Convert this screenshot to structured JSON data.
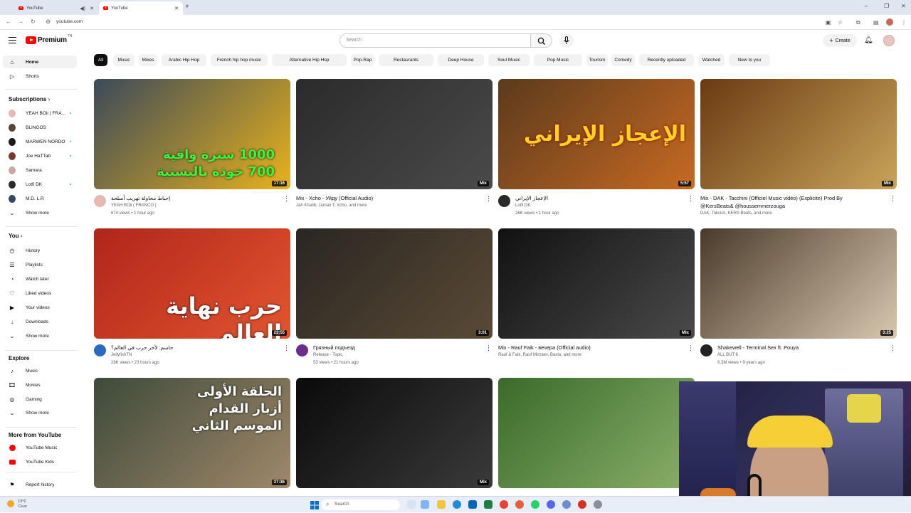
{
  "browser": {
    "tabs": [
      {
        "title": "YouTube",
        "active": false
      },
      {
        "title": "YouTube",
        "active": true
      }
    ],
    "url": "youtube.com"
  },
  "header": {
    "logo_text": "Premium",
    "logo_sup": "TN",
    "search_placeholder": "Search",
    "create_label": "Create"
  },
  "chips": [
    "All",
    "Music",
    "Mixes",
    "Arabic Hip Hop",
    "French hip hop music",
    "Alternative Hip Hop",
    "Pop-Rap",
    "Restaurants",
    "Deep House",
    "Soul Music",
    "Pop Music",
    "Tourism",
    "Comedy",
    "Recently uploaded",
    "Watched",
    "New to you"
  ],
  "sidebar": {
    "top": [
      {
        "label": "Home",
        "icon": "home-icon"
      },
      {
        "label": "Shorts",
        "icon": "shorts-icon"
      }
    ],
    "subscriptions_title": "Subscriptions",
    "subscriptions": [
      {
        "label": "YEAH BOii ( FRA...",
        "dot": true,
        "color": "#e6b9b3"
      },
      {
        "label": "BLINGOS",
        "dot": false,
        "color": "#5a4636"
      },
      {
        "label": "MARWEN NORDO",
        "dot": true,
        "color": "#1a1a1a"
      },
      {
        "label": "Joe HaTTab",
        "dot": true,
        "color": "#7a3a2a"
      },
      {
        "label": "Samara",
        "dot": false,
        "color": "#c9a9a0"
      },
      {
        "label": "Lotfi DK",
        "dot": true,
        "color": "#2a2a2a"
      },
      {
        "label": "M.D. L.R",
        "dot": false,
        "color": "#34495e"
      }
    ],
    "show_more": "Show more",
    "you_title": "You",
    "you": [
      {
        "label": "History",
        "icon": "history-icon"
      },
      {
        "label": "Playlists",
        "icon": "playlists-icon"
      },
      {
        "label": "Watch later",
        "icon": "watch-later-icon"
      },
      {
        "label": "Liked videos",
        "icon": "like-icon"
      },
      {
        "label": "Your videos",
        "icon": "your-videos-icon"
      },
      {
        "label": "Downloads",
        "icon": "download-icon"
      }
    ],
    "explore_title": "Explore",
    "explore": [
      {
        "label": "Music",
        "icon": "music-icon"
      },
      {
        "label": "Movies",
        "icon": "movies-icon"
      },
      {
        "label": "Gaming",
        "icon": "gaming-icon"
      }
    ],
    "more_title": "More from YouTube",
    "more": [
      {
        "label": "YouTube Music",
        "icon": "youtube-music-icon"
      },
      {
        "label": "YouTube Kids",
        "icon": "youtube-kids-icon"
      }
    ],
    "report": "Report history"
  },
  "videos": [
    {
      "title": "إحباط محاولة تهريب أسلحة",
      "channel": "YEAH BOii ( FRANCO )",
      "views": "674 views • 1 hour ago",
      "duration": "17:16",
      "overlay": "1000 سترة واقية\n700 خوذة باليستية",
      "colors": [
        "#3b4a5a",
        "#e8b21b"
      ],
      "ava": "#e6b9b3"
    },
    {
      "title": "Mix - Xcho - Уйду (Official Audio)",
      "channel": "Jah Khalib, Jaman T, Xcho, and more",
      "views": "",
      "duration": "Mix",
      "overlay": "",
      "colors": [
        "#2b2b2b",
        "#4a4a4a"
      ],
      "ava": ""
    },
    {
      "title": "الإعجاز الإيراني",
      "channel": "Lotfi DK",
      "views": "26K views • 1 hour ago",
      "duration": "5:57",
      "overlay": "الإعجاز الإيراني",
      "colors": [
        "#5b3a1c",
        "#c86a22"
      ],
      "ava": "#2a2a2a"
    },
    {
      "title": "Mix - DAK - Tacchini (Officiel Music vidéo) (Explicite) Prod By @KersBeats& @houssemmerzouga",
      "channel": "DAK, Tokcick, KERS Beats, and more",
      "views": "",
      "duration": "Mix",
      "overlay": "",
      "colors": [
        "#6b3a12",
        "#c9a45a"
      ],
      "ava": ""
    },
    {
      "title": "حاسم: لأخر حرب في العالم؟",
      "channel": "JellyfishTN",
      "views": "28K views • 23 hours ago",
      "duration": "23:55",
      "overlay": "حرب نهاية العالم",
      "colors": [
        "#b0251b",
        "#e3552f"
      ],
      "ava": "#2a6bbf"
    },
    {
      "title": "Грязный подъезд",
      "channel": "Release - Topic",
      "views": "53 views • 21 hours ago",
      "duration": "3:01",
      "overlay": "",
      "colors": [
        "#2a2622",
        "#5a4a36"
      ],
      "ava": "#6a2e8a"
    },
    {
      "title": "Mix - Rauf Faik - вечера (Official audio)",
      "channel": "Rauf & Faik, Rauf Mirzaev, Basta, and more",
      "views": "",
      "duration": "Mix",
      "overlay": "",
      "colors": [
        "#111111",
        "#4a4a4a"
      ],
      "ava": ""
    },
    {
      "title": "Shakewell - Terminal Sex ft. Pouya",
      "channel": "ALL BUT 6",
      "views": "6.3M views • 9 years ago",
      "duration": "3:25",
      "overlay": "",
      "colors": [
        "#4a3a2a",
        "#d8c8b0"
      ],
      "ava": "#222222"
    },
    {
      "title": "",
      "channel": "",
      "views": "",
      "duration": "37:36",
      "overlay": "الحلقة الأولى\nأزبار القدام\nالموسم الثاني",
      "colors": [
        "#3d4a3a",
        "#a0886a"
      ],
      "ava": ""
    },
    {
      "title": "",
      "channel": "",
      "views": "",
      "duration": "Mix",
      "overlay": "",
      "colors": [
        "#0a0a0a",
        "#3a3a3a"
      ],
      "ava": ""
    },
    {
      "title": "",
      "channel": "",
      "views": "",
      "duration": "Mix",
      "overlay": "",
      "colors": [
        "#3a6a2a",
        "#8ab06a"
      ],
      "ava": ""
    }
  ],
  "weather": {
    "temp": "13°C",
    "desc": "Clear"
  },
  "taskbar": {
    "search": "Search"
  }
}
